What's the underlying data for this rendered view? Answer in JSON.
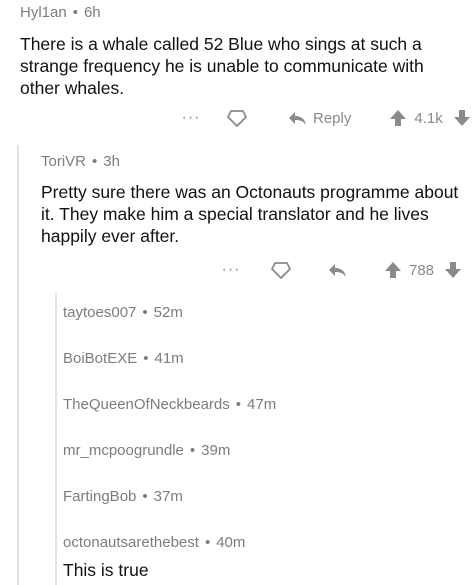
{
  "comment1": {
    "author": "Hyl1an",
    "age": "6h",
    "body": "There is a whale called 52 Blue who sings at such a strange frequency he is unable to communicate with other whales.",
    "more_label": "···",
    "reply_label": "Reply",
    "score": "4.1k"
  },
  "comment2": {
    "author": "ToriVR",
    "age": "3h",
    "body": "Pretty sure there was an Octonauts programme about it. They make him a special translator and he lives happily ever after.",
    "more_label": "···",
    "score": "788"
  },
  "replies": [
    {
      "author": "taytoes007",
      "age": "52m"
    },
    {
      "author": "BoiBotEXE",
      "age": "41m"
    },
    {
      "author": "TheQueenOfNeckbeards",
      "age": "47m"
    },
    {
      "author": "mr_mcpoogrundle",
      "age": "39m"
    },
    {
      "author": "FartingBob",
      "age": "37m"
    },
    {
      "author": "octonautsarethebest",
      "age": "40m",
      "body": "This is true"
    }
  ],
  "separator": "•",
  "colors": {
    "text": "#111111",
    "meta": "#7c7c7c",
    "icon": "#8a8a8a",
    "thread_line": "#e2e2e2"
  },
  "icons": [
    "more-icon",
    "gild-icon",
    "reply-icon",
    "upvote-icon",
    "downvote-icon"
  ]
}
